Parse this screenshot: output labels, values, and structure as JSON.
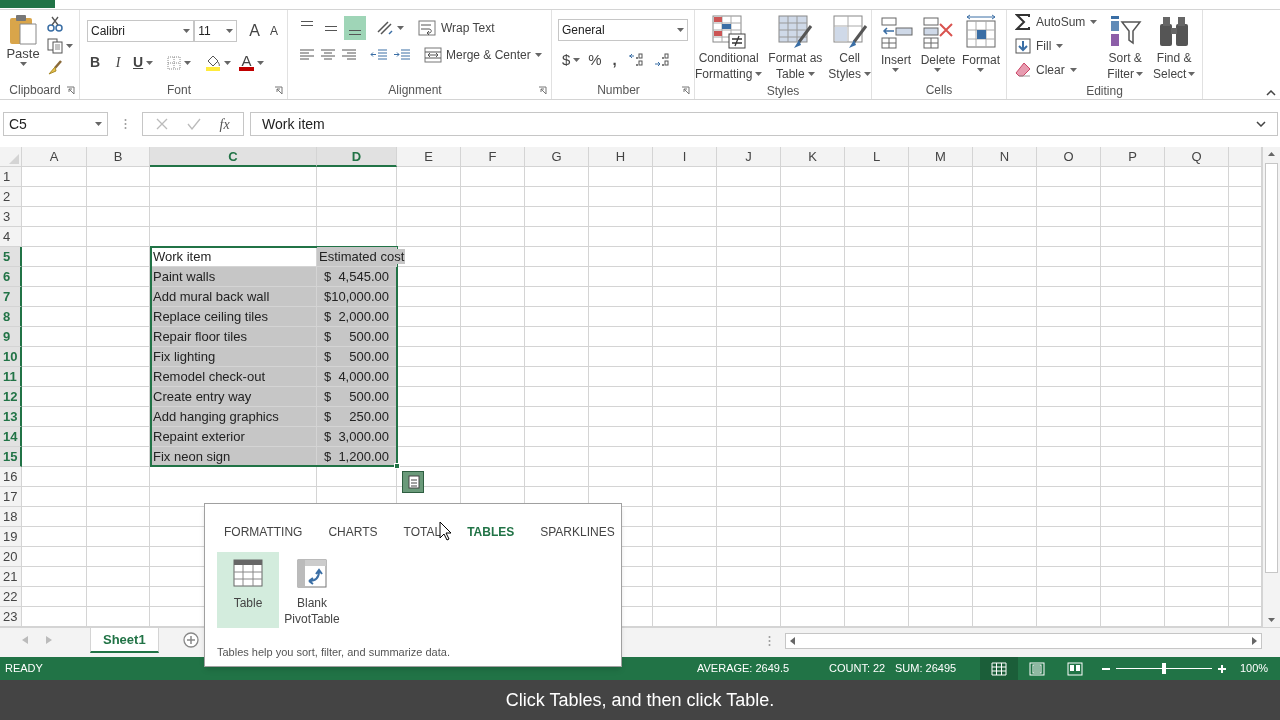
{
  "ribbon": {
    "clipboard": {
      "label": "Clipboard",
      "paste": "Paste"
    },
    "font": {
      "label": "Font",
      "name": "Calibri",
      "size": "11",
      "grow": "A",
      "shrink": "A",
      "bold": "B",
      "italic": "I",
      "underline": "U",
      "font_color": "A"
    },
    "alignment": {
      "label": "Alignment",
      "vertical": [
        {
          "selected": false
        },
        {
          "selected": false
        },
        {
          "selected": true
        }
      ],
      "wrap_text": "Wrap Text",
      "merge": "Merge & Center"
    },
    "number": {
      "label": "Number",
      "format": "General",
      "currency": "$",
      "percent": "%",
      "comma": ","
    },
    "styles": {
      "label": "Styles",
      "buttons": [
        {
          "kind": "conditional",
          "lines": [
            "Conditional",
            "Formatting"
          ]
        },
        {
          "kind": "format_table",
          "lines": [
            "Format as",
            "Table"
          ]
        },
        {
          "kind": "cell_styles",
          "lines": [
            "Cell",
            "Styles"
          ]
        }
      ]
    },
    "cells": {
      "label": "Cells",
      "buttons": [
        {
          "kind": "insert",
          "label": "Insert"
        },
        {
          "kind": "delete",
          "label": "Delete"
        },
        {
          "kind": "format",
          "label": "Format"
        }
      ]
    },
    "editing": {
      "label": "Editing",
      "small": [
        {
          "kind": "autosum",
          "label": "AutoSum"
        },
        {
          "kind": "fill",
          "label": "Fill"
        },
        {
          "kind": "clear",
          "label": "Clear"
        }
      ],
      "large": [
        {
          "kind": "sort",
          "lines": [
            "Sort &",
            "Filter"
          ]
        },
        {
          "kind": "find",
          "lines": [
            "Find &",
            "Select"
          ]
        }
      ]
    }
  },
  "formula_bar": {
    "name_box": "C5",
    "fx": "fx",
    "value": "Work item"
  },
  "sheet": {
    "columns": [
      {
        "label": "A",
        "selected": false
      },
      {
        "label": "B",
        "selected": false
      },
      {
        "label": "C",
        "selected": true
      },
      {
        "label": "D",
        "selected": true
      },
      {
        "label": "E",
        "selected": false
      },
      {
        "label": "F",
        "selected": false
      },
      {
        "label": "G",
        "selected": false
      },
      {
        "label": "H",
        "selected": false
      },
      {
        "label": "I",
        "selected": false
      },
      {
        "label": "J",
        "selected": false
      },
      {
        "label": "K",
        "selected": false
      },
      {
        "label": "L",
        "selected": false
      },
      {
        "label": "M",
        "selected": false
      },
      {
        "label": "N",
        "selected": false
      },
      {
        "label": "O",
        "selected": false
      },
      {
        "label": "P",
        "selected": false
      },
      {
        "label": "Q",
        "selected": false
      }
    ],
    "rows": [
      {
        "label": "1",
        "selected": false
      },
      {
        "label": "2",
        "selected": false
      },
      {
        "label": "3",
        "selected": false
      },
      {
        "label": "4",
        "selected": false
      },
      {
        "label": "5",
        "selected": true
      },
      {
        "label": "6",
        "selected": true
      },
      {
        "label": "7",
        "selected": true
      },
      {
        "label": "8",
        "selected": true
      },
      {
        "label": "9",
        "selected": true
      },
      {
        "label": "10",
        "selected": true
      },
      {
        "label": "11",
        "selected": true
      },
      {
        "label": "12",
        "selected": true
      },
      {
        "label": "13",
        "selected": true
      },
      {
        "label": "14",
        "selected": true
      },
      {
        "label": "15",
        "selected": true
      },
      {
        "label": "16",
        "selected": false
      },
      {
        "label": "17",
        "selected": false
      },
      {
        "label": "18",
        "selected": false
      },
      {
        "label": "19",
        "selected": false
      },
      {
        "label": "20",
        "selected": false
      },
      {
        "label": "21",
        "selected": false
      },
      {
        "label": "22",
        "selected": false
      },
      {
        "label": "23",
        "selected": false
      }
    ],
    "header": {
      "item": "Work item",
      "cost": "Estimated cost"
    },
    "data": [
      {
        "item": "Paint walls",
        "currency": "$",
        "amount": "4,545.00"
      },
      {
        "item": "Add mural back wall",
        "currency": "$",
        "amount": "10,000.00"
      },
      {
        "item": "Replace ceiling tiles",
        "currency": "$",
        "amount": "2,000.00"
      },
      {
        "item": "Repair floor tiles",
        "currency": "$",
        "amount": "500.00"
      },
      {
        "item": "Fix lighting",
        "currency": "$",
        "amount": "500.00"
      },
      {
        "item": "Remodel check-out",
        "currency": "$",
        "amount": "4,000.00"
      },
      {
        "item": "Create entry way",
        "currency": "$",
        "amount": "500.00"
      },
      {
        "item": "Add hanging graphics",
        "currency": "$",
        "amount": "250.00"
      },
      {
        "item": "Repaint exterior",
        "currency": "$",
        "amount": "3,000.00"
      },
      {
        "item": "Fix neon sign",
        "currency": "$",
        "amount": "1,200.00"
      }
    ]
  },
  "sheet_tabs": [
    {
      "label": "Sheet1",
      "selected": true
    }
  ],
  "quick_analysis": {
    "tabs": [
      {
        "label": "FORMATTING",
        "selected": false
      },
      {
        "label": "CHARTS",
        "selected": false
      },
      {
        "label": "TOTAL",
        "selected": false
      },
      {
        "label": "TABLES",
        "selected": true
      },
      {
        "label": "SPARKLINES",
        "selected": false
      }
    ],
    "options": [
      {
        "kind": "table",
        "lines": [
          "Table"
        ],
        "selected": true
      },
      {
        "kind": "pivot",
        "lines": [
          "Blank",
          "PivotTable"
        ],
        "selected": false
      }
    ],
    "description": "Tables help you sort, filter, and summarize data."
  },
  "status_bar": {
    "mode": "READY",
    "average": "AVERAGE: 2649.5",
    "count": "COUNT: 22",
    "sum": "SUM: 26495",
    "views": [
      {
        "kind": "normal",
        "selected": true
      },
      {
        "kind": "page_layout",
        "selected": false
      },
      {
        "kind": "page_break",
        "selected": false
      }
    ],
    "zoom": {
      "level": 0.5
    },
    "zoom_label": "100%"
  },
  "caption": "Click Tables, and then click Table."
}
